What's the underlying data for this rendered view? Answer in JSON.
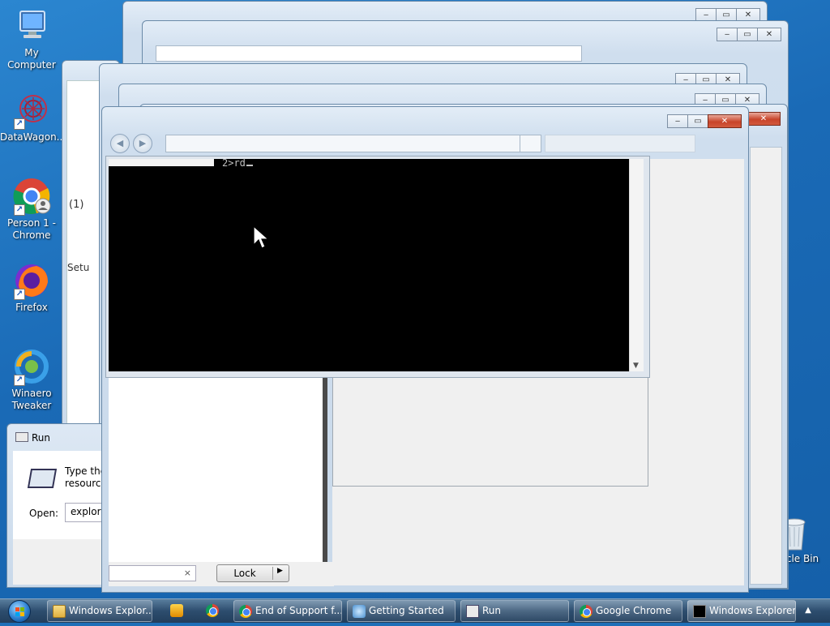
{
  "desktop": {
    "icons": [
      {
        "label": "My Computer"
      },
      {
        "label": "DataWagon..."
      },
      {
        "label": "Person 1 - Chrome"
      },
      {
        "label": "Firefox"
      },
      {
        "label": "Winaero Tweaker"
      },
      {
        "label": "cle Bin"
      }
    ]
  },
  "background_windows": {
    "partial_text_1": "(1)",
    "partial_text_2": "Setu"
  },
  "console": {
    "prompt_text": "2>rd"
  },
  "run_dialog": {
    "title": "Run",
    "description_line1": "Type the",
    "description_line2": "resource,",
    "open_label": "Open:",
    "open_value": "explorer"
  },
  "explorer_panel": {
    "lock_button_label": "Lock",
    "search_clear": "×",
    "split_arrow": "▶"
  },
  "taskbar": {
    "buttons": [
      {
        "label": "Windows Explor..."
      },
      {
        "label": "End of Support f..."
      },
      {
        "label": "Getting Started"
      },
      {
        "label": "Run"
      },
      {
        "label": "Google Chrome"
      },
      {
        "label": "Windows Explorer"
      }
    ],
    "notification_arrow": "▲"
  }
}
